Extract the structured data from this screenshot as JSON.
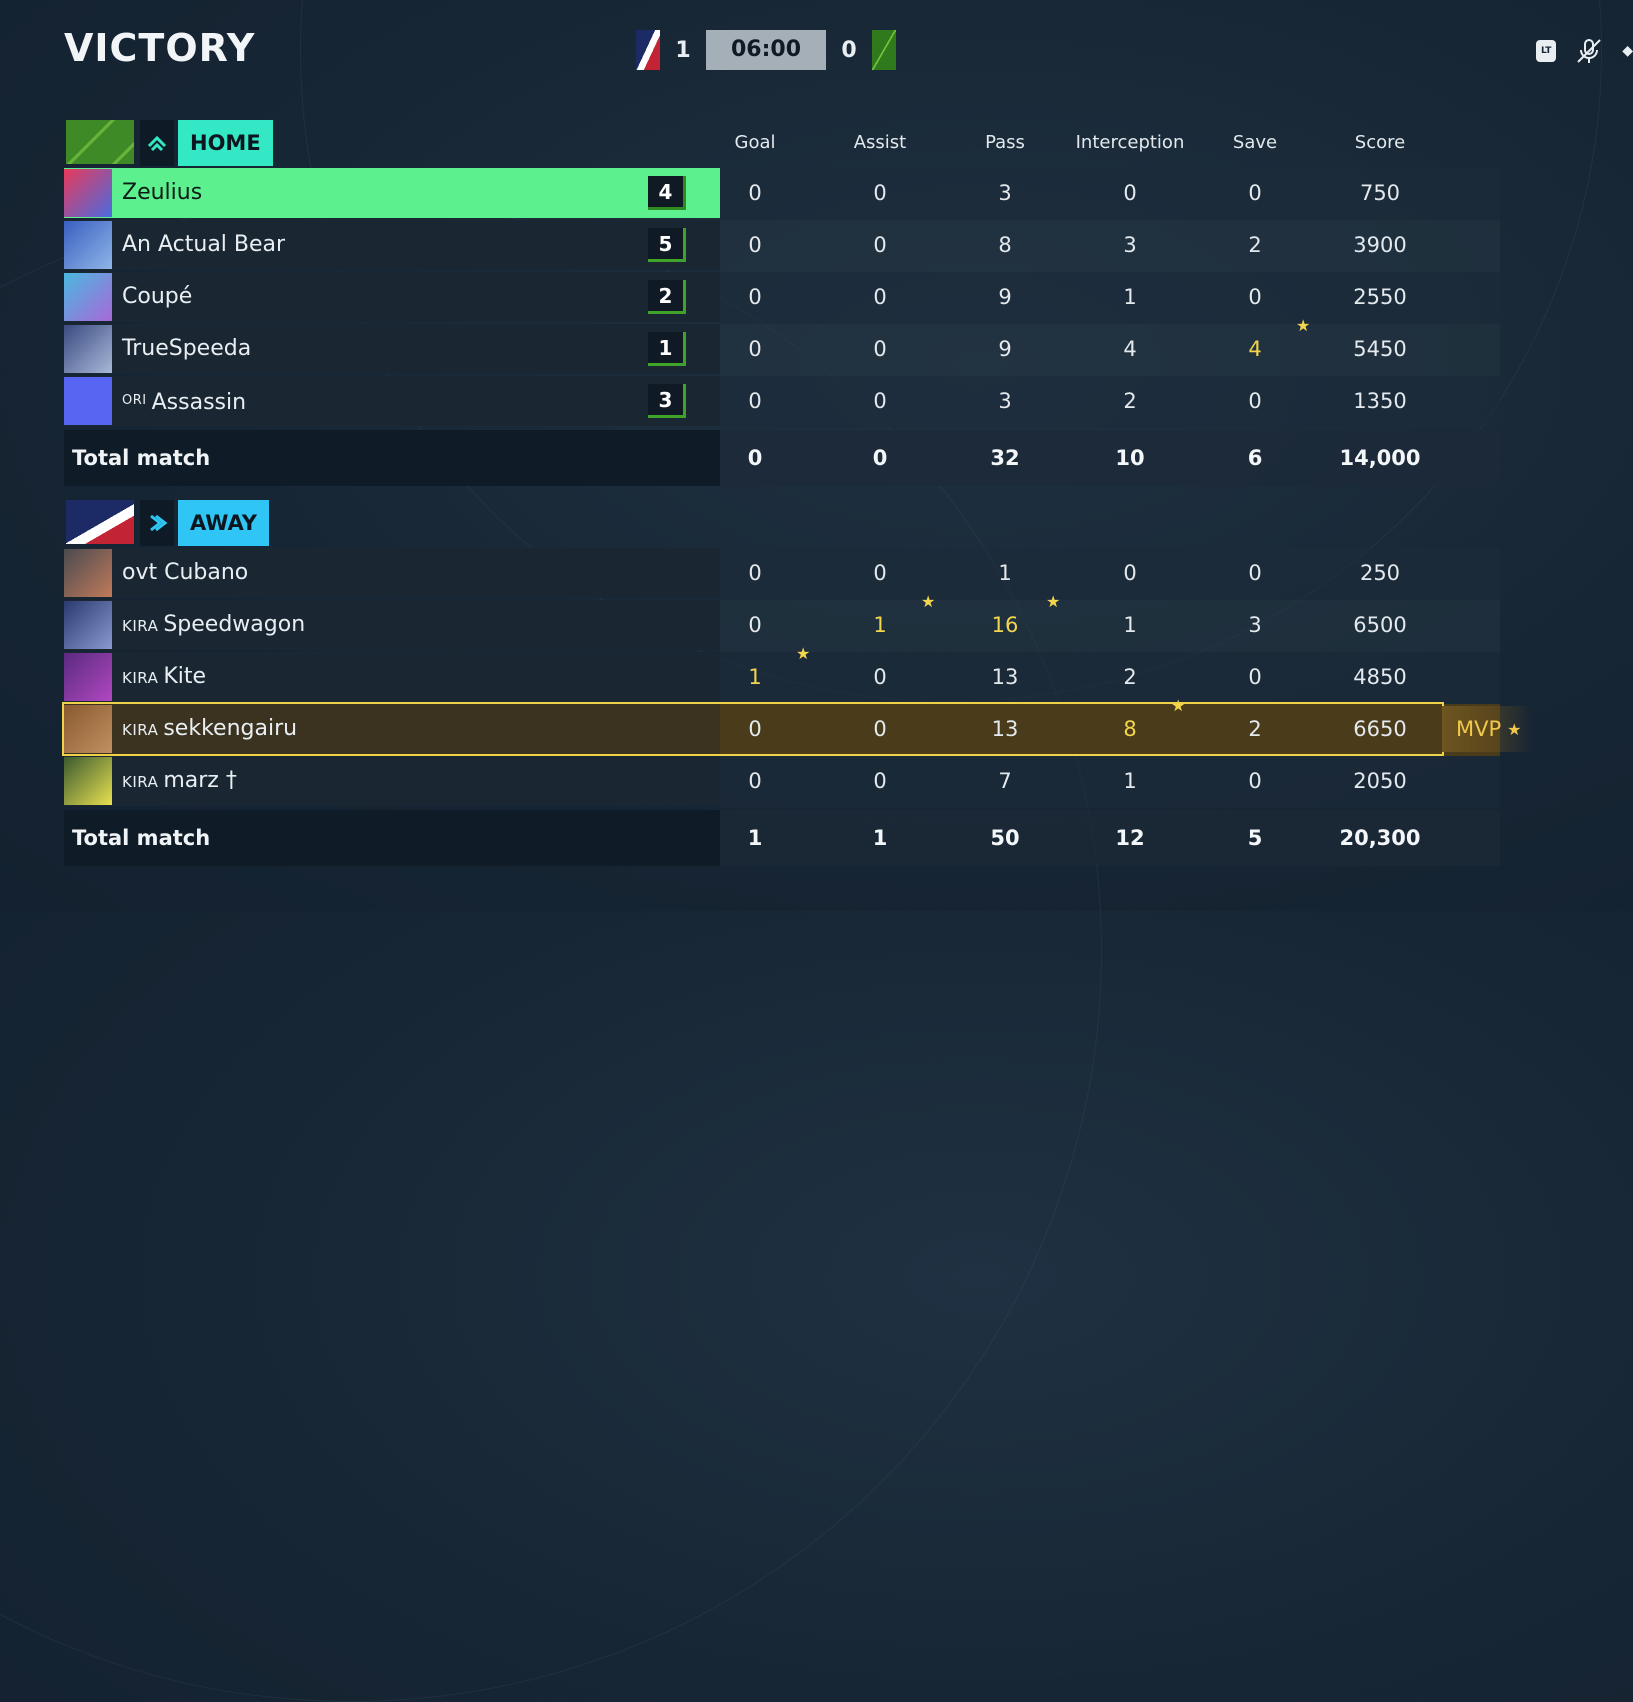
{
  "header": {
    "result": "VICTORY",
    "left_score": "1",
    "clock": "06:00",
    "right_score": "0",
    "icons": [
      "lt-button-icon",
      "mic-muted-icon",
      "dot-icon"
    ]
  },
  "columns": [
    "Goal",
    "Assist",
    "Pass",
    "Interception",
    "Save",
    "Score"
  ],
  "home": {
    "label": "HOME",
    "players": [
      {
        "tag": "",
        "name": "Zeulius",
        "number": "4",
        "stats": [
          "0",
          "0",
          "3",
          "0",
          "0",
          "750"
        ],
        "highlight": true
      },
      {
        "tag": "",
        "name": "An Actual Bear",
        "number": "5",
        "stats": [
          "0",
          "0",
          "8",
          "3",
          "2",
          "3900"
        ]
      },
      {
        "tag": "",
        "name": "Coupé",
        "number": "2",
        "stats": [
          "0",
          "0",
          "9",
          "1",
          "0",
          "2550"
        ]
      },
      {
        "tag": "",
        "name": "TrueSpeeda",
        "number": "1",
        "stats": [
          "0",
          "0",
          "9",
          "4",
          "4",
          "5450"
        ],
        "gold": [
          4
        ]
      },
      {
        "tag": "ORI",
        "name": "Assassin",
        "number": "3",
        "stats": [
          "0",
          "0",
          "3",
          "2",
          "0",
          "1350"
        ]
      }
    ],
    "total_label": "Total match",
    "totals": [
      "0",
      "0",
      "32",
      "10",
      "6",
      "14,000"
    ]
  },
  "away": {
    "label": "AWAY",
    "players": [
      {
        "tag": "",
        "name": "ovt Cubano",
        "stats": [
          "0",
          "0",
          "1",
          "0",
          "0",
          "250"
        ]
      },
      {
        "tag": "KIRA",
        "name": "Speedwagon",
        "stats": [
          "0",
          "1",
          "16",
          "1",
          "3",
          "6500"
        ],
        "gold": [
          1,
          2
        ]
      },
      {
        "tag": "KIRA",
        "name": "Kite",
        "stats": [
          "1",
          "0",
          "13",
          "2",
          "0",
          "4850"
        ],
        "gold": [
          0
        ]
      },
      {
        "tag": "KIRA",
        "name": "sekkengairu",
        "stats": [
          "0",
          "0",
          "13",
          "8",
          "2",
          "6650"
        ],
        "gold": [
          3
        ],
        "mvp": true
      },
      {
        "tag": "KIRA",
        "name": "marz †",
        "stats": [
          "0",
          "0",
          "7",
          "1",
          "0",
          "2050"
        ]
      }
    ],
    "total_label": "Total match",
    "totals": [
      "1",
      "1",
      "50",
      "12",
      "5",
      "20,300"
    ],
    "mvp_label": "MVP"
  },
  "colors": {
    "home_accent": "#34e8c6",
    "away_accent": "#2fc6f5",
    "highlight_row": "#5df08e",
    "gold": "#f4d64e"
  }
}
